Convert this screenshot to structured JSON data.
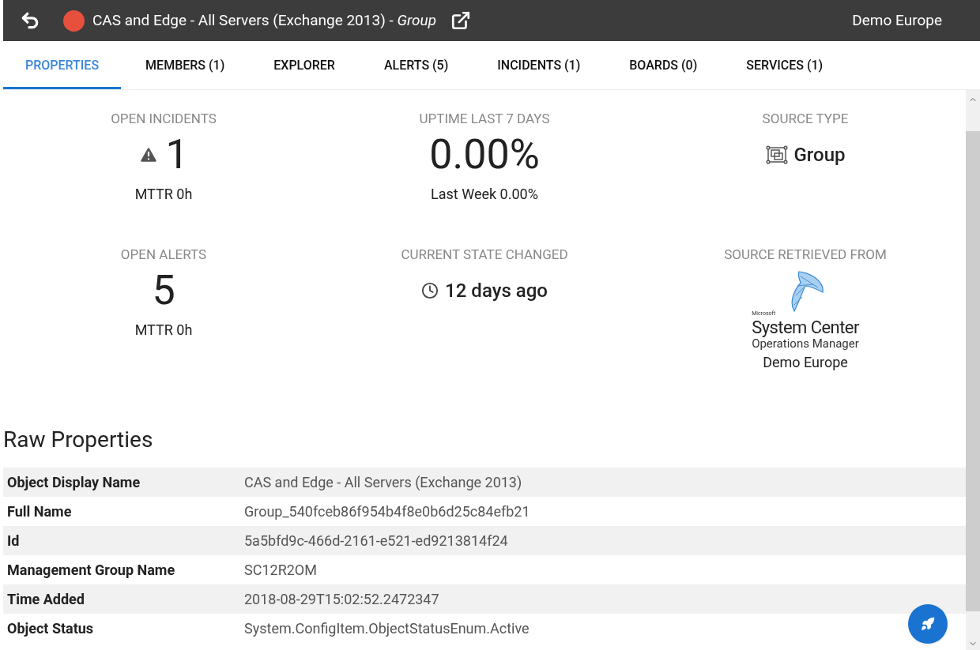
{
  "header": {
    "color": "#e8503e",
    "title": "CAS and Edge - All Servers (Exchange 2013) - *Group*",
    "location": "Demo Europe"
  },
  "tabs": [
    {
      "label": "PROPERTIES",
      "selected": true
    },
    {
      "label": "MEMBERS (1)",
      "selected": false
    },
    {
      "label": "EXPLORER",
      "selected": false
    },
    {
      "label": "ALERTS (5)",
      "selected": false
    },
    {
      "label": "INCIDENTS (1)",
      "selected": false
    },
    {
      "label": "BOARDS (0)",
      "selected": false
    },
    {
      "label": "SERVICES (1)",
      "selected": false
    }
  ],
  "stats": [
    {
      "kind": "incidents",
      "label": "OPEN INCIDENTS",
      "value": "1",
      "note": "MTTR 0h"
    },
    {
      "kind": "uptime",
      "label": "UPTIME LAST 7 DAYS",
      "value": "0.00%",
      "note": "Last Week 0.00%"
    },
    {
      "kind": "type",
      "label": "SOURCE TYPE",
      "value": "Group"
    },
    {
      "kind": "plain",
      "label": "OPEN ALERTS",
      "value": "5",
      "note": "MTTR 0h"
    },
    {
      "kind": "time",
      "label": "CURRENT STATE CHANGED",
      "value": "12 days ago"
    },
    {
      "kind": "source",
      "label": "SOURCE RETRIEVED FROM",
      "logo_brand": "Microsoft",
      "logo_title": "System Center",
      "logo_subtitle": "Operations Manager",
      "note": "Demo Europe"
    }
  ],
  "raw_properties": {
    "title": "Raw Properties",
    "rows": [
      {
        "name": "Object Display Name",
        "value": "CAS and Edge - All Servers (Exchange 2013)"
      },
      {
        "name": "Full Name",
        "value": "Group_540fceb86f954b4f8e0b6d25c84efb21"
      },
      {
        "name": "Id",
        "value": "5a5bfd9c-466d-2161-e521-ed9213814f24"
      },
      {
        "name": "Management Group Name",
        "value": "SC12R2OM"
      },
      {
        "name": "Time Added",
        "value": "2018-08-29T15:02:52.2472347"
      },
      {
        "name": "Object Status",
        "value": "System.ConfigItem.ObjectStatusEnum.Active"
      }
    ]
  }
}
